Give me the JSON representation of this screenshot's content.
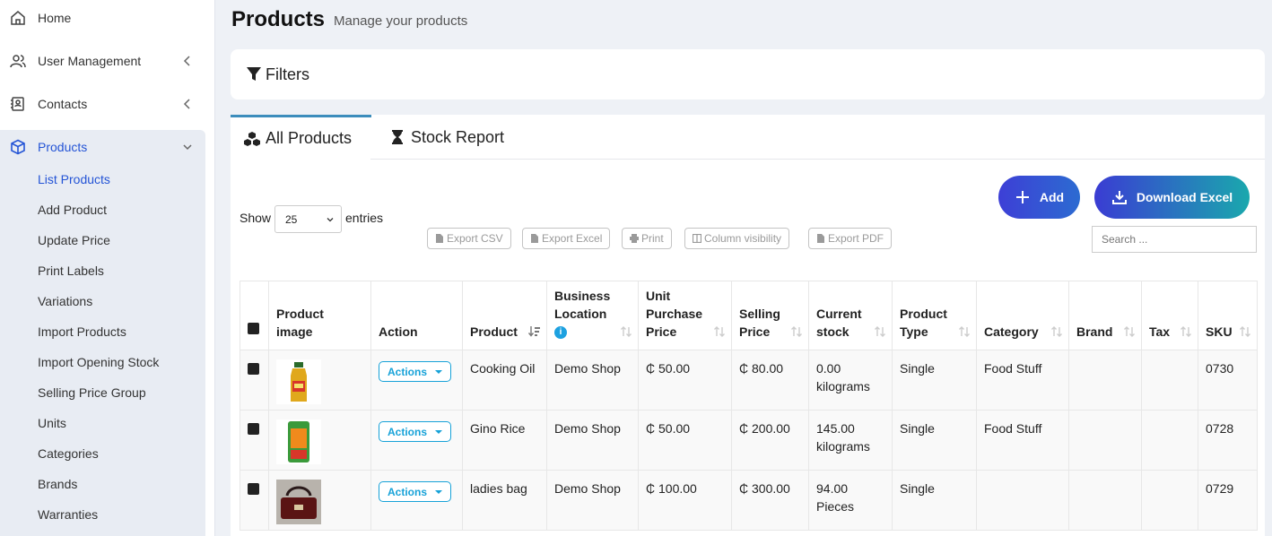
{
  "sidebar": {
    "items": [
      {
        "label": "Home",
        "icon": "home-icon"
      },
      {
        "label": "User Management",
        "icon": "users-icon"
      },
      {
        "label": "Contacts",
        "icon": "address-book-icon"
      },
      {
        "label": "Products",
        "icon": "cube-icon"
      }
    ],
    "products_sub": [
      "List Products",
      "Add Product",
      "Update Price",
      "Print Labels",
      "Variations",
      "Import Products",
      "Import Opening Stock",
      "Selling Price Group",
      "Units",
      "Categories",
      "Brands",
      "Warranties"
    ]
  },
  "header": {
    "title": "Products",
    "subtitle": "Manage your products"
  },
  "filters": {
    "label": "Filters"
  },
  "tabs": [
    {
      "label": "All Products"
    },
    {
      "label": "Stock Report"
    }
  ],
  "buttons": {
    "add": "Add",
    "download": "Download Excel"
  },
  "table_controls": {
    "show": "Show",
    "entries": "entries",
    "page_length": "25",
    "search_placeholder": "Search ...",
    "exports": [
      "Export CSV",
      "Export Excel",
      "Print",
      "Column visibility",
      "Export PDF"
    ]
  },
  "table": {
    "headers": {
      "image": "Product image",
      "action": "Action",
      "product": "Product",
      "location": "Business Location",
      "purchase": "Unit Purchase Price",
      "selling": "Selling Price",
      "stock": "Current stock",
      "type": "Product Type",
      "category": "Category",
      "brand": "Brand",
      "tax": "Tax",
      "sku": "SKU"
    },
    "action_label": "Actions",
    "rows": [
      {
        "product": "Cooking Oil",
        "location": "Demo Shop",
        "purchase": "₵ 50.00",
        "selling": "₵ 80.00",
        "stock": "0.00 kilograms",
        "type": "Single",
        "category": "Food Stuff",
        "brand": "",
        "tax": "",
        "sku": "0730"
      },
      {
        "product": "Gino Rice",
        "location": "Demo Shop",
        "purchase": "₵ 50.00",
        "selling": "₵ 200.00",
        "stock": "145.00 kilograms",
        "type": "Single",
        "category": "Food Stuff",
        "brand": "",
        "tax": "",
        "sku": "0728"
      },
      {
        "product": "ladies bag",
        "location": "Demo Shop",
        "purchase": "₵ 100.00",
        "selling": "₵ 300.00",
        "stock": "94.00 Pieces",
        "type": "Single",
        "category": "",
        "brand": "",
        "tax": "",
        "sku": "0729"
      }
    ]
  },
  "colors": {
    "accent": "#2454d6",
    "action": "#17a2d8",
    "tab_border": "#3c8dbc"
  }
}
